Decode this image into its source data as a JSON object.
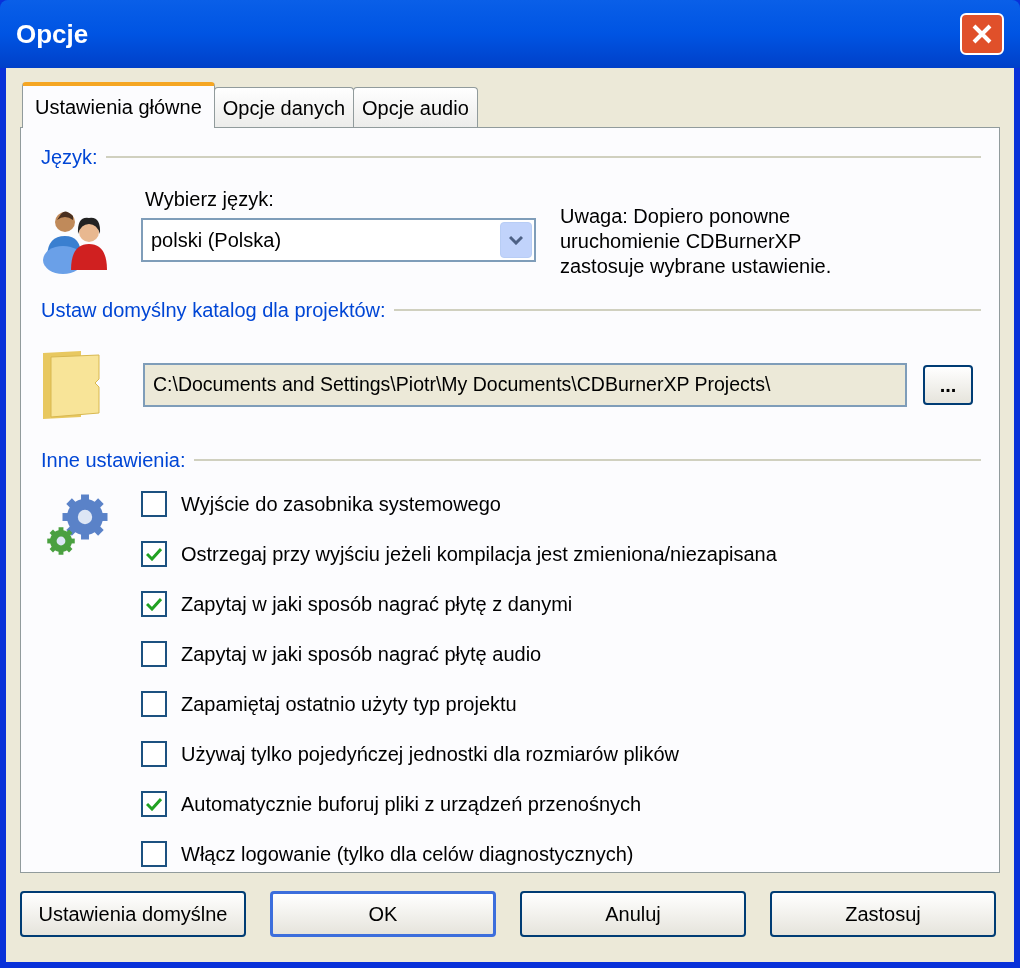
{
  "window": {
    "title": "Opcje"
  },
  "tabs": [
    {
      "label": "Ustawienia główne",
      "selected": true
    },
    {
      "label": "Opcje danych",
      "selected": false
    },
    {
      "label": "Opcje audio",
      "selected": false
    }
  ],
  "language": {
    "heading": "Język:",
    "label": "Wybierz język:",
    "value": "polski (Polska)",
    "note": "Uwaga: Dopiero ponowne uruchomienie CDBurnerXP zastosuje wybrane ustawienie."
  },
  "project_folder": {
    "heading": "Ustaw domyślny katalog dla projektów:",
    "value": "C:\\Documents and Settings\\Piotr\\My Documents\\CDBurnerXP Projects\\",
    "browse": "..."
  },
  "other": {
    "heading": "Inne ustawienia:",
    "options": [
      {
        "label": "Wyjście do zasobnika systemowego",
        "checked": false
      },
      {
        "label": "Ostrzegaj przy wyjściu jeżeli kompilacja jest zmieniona/niezapisana",
        "checked": true
      },
      {
        "label": "Zapytaj w jaki sposób nagrać płytę z danymi",
        "checked": true
      },
      {
        "label": "Zapytaj w jaki sposób nagrać płytę audio",
        "checked": false
      },
      {
        "label": "Zapamiętaj ostatnio użyty typ projektu",
        "checked": false
      },
      {
        "label": "Używaj tylko pojedyńczej jednostki dla rozmiarów plików",
        "checked": false
      },
      {
        "label": "Automatycznie buforuj pliki z urządzeń przenośnych",
        "checked": true
      },
      {
        "label": "Włącz logowanie (tylko dla celów diagnostycznych)",
        "checked": false
      }
    ]
  },
  "buttons": [
    {
      "label": "Ustawienia domyślne",
      "default": false
    },
    {
      "label": "OK",
      "default": true
    },
    {
      "label": "Anuluj",
      "default": false
    },
    {
      "label": "Zastosuj",
      "default": false
    }
  ]
}
